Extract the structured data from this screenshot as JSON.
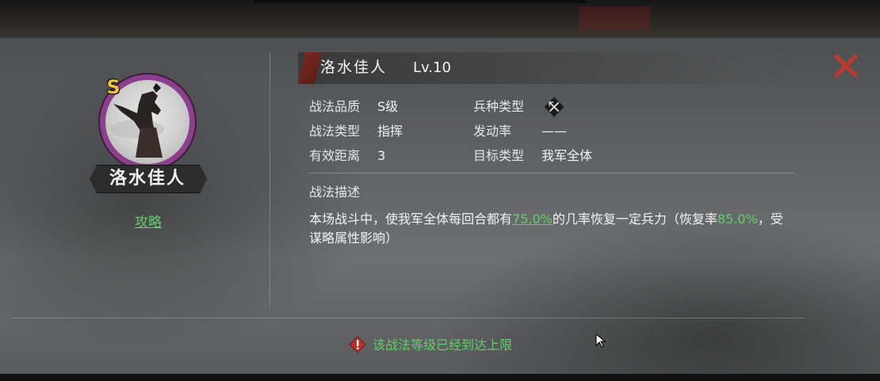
{
  "skill": {
    "name": "洛水佳人",
    "level": "Lv.10",
    "grade_badge": "S",
    "portrait_name": "洛水佳人",
    "strategy_link": "攻略"
  },
  "attributes": {
    "quality_label": "战法品质",
    "quality_value": "S级",
    "type_label": "战法类型",
    "type_value": "指挥",
    "range_label": "有效距离",
    "range_value": "3",
    "troop_label": "兵种类型",
    "troop_icon": "crossed-weapons-icon",
    "rate_label": "发动率",
    "rate_value": "——",
    "target_label": "目标类型",
    "target_value": "我军全体"
  },
  "description": {
    "title": "战法描述",
    "part1": "本场战斗中，使我军全体每回合都有",
    "chance": "75.0%",
    "part2": "的几率恢复一定兵力（恢复率",
    "heal_rate": "85.0%",
    "part3": "，受谋略属性影响）"
  },
  "footer": {
    "notice": "该战法等级已经到达上限"
  },
  "colors": {
    "highlight": "#5fcf6a",
    "close_red": "#c0392b",
    "badge_gold": "#e8c23a",
    "portrait_ring": "#8c3f8c"
  }
}
